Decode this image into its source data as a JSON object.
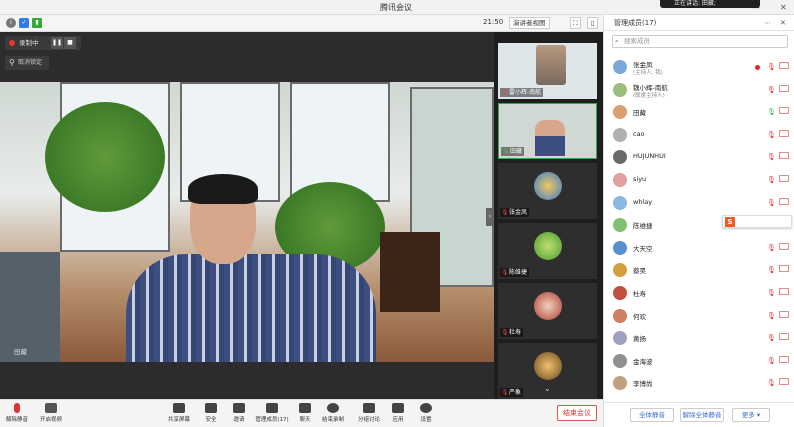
{
  "window": {
    "title": "腾讯会议",
    "speaking_label": "正在讲话: 田藏;"
  },
  "subbar": {
    "time": "21:50",
    "view_label": "演讲者视图"
  },
  "recording": {
    "label": "录制中"
  },
  "pin": {
    "label": "取消锁定"
  },
  "main_video": {
    "speaker_label": "田藏"
  },
  "thumbnails": [
    {
      "label": "雷小辉-南航"
    },
    {
      "label": "田藏"
    },
    {
      "label": "张金凤"
    },
    {
      "label": "陈维捷"
    },
    {
      "label": "杜寿"
    },
    {
      "label": "严象"
    }
  ],
  "panel": {
    "title": "管理成员(17)",
    "search_placeholder": "搜索成员",
    "members": [
      {
        "name": "张金凤",
        "sub": "(主持人, 我)",
        "status": "recording"
      },
      {
        "name": "魏小辉-南航",
        "sub": "(联席主持人)"
      },
      {
        "name": "田藏",
        "status": "speaking"
      },
      {
        "name": "cao"
      },
      {
        "name": "HUJUNHUI"
      },
      {
        "name": "siyu"
      },
      {
        "name": "whlay"
      },
      {
        "name": "陈维捷"
      },
      {
        "name": "大天空"
      },
      {
        "name": "蔡昊"
      },
      {
        "name": "杜寿"
      },
      {
        "name": "何欢"
      },
      {
        "name": "黄扬"
      },
      {
        "name": "金海波"
      },
      {
        "name": "李博尚"
      }
    ],
    "footer": {
      "mute_all": "全体静音",
      "unmute_all": "解除全体静音",
      "more": "更多"
    }
  },
  "toolbar": {
    "unmute": "解除静音",
    "video": "开启视频",
    "share": "共享屏幕",
    "security": "安全",
    "invite": "邀请",
    "members": "管理成员(17)",
    "chat": "聊天",
    "record": "结束录制",
    "breakout": "分组讨论",
    "apps": "应用",
    "settings": "设置",
    "end": "结束会议"
  }
}
